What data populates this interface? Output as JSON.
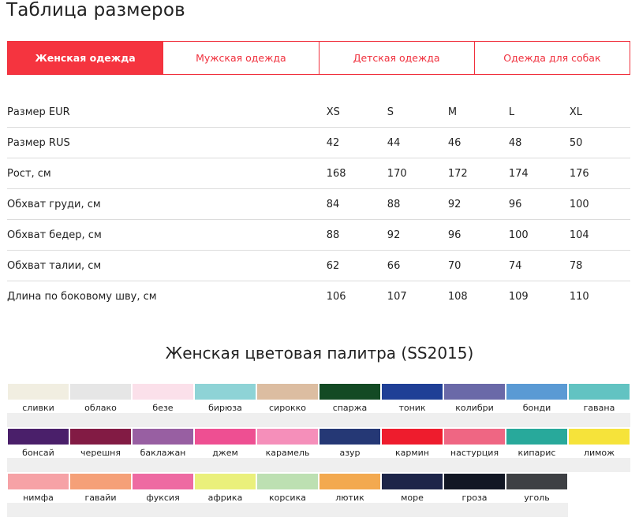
{
  "page": {
    "title": "Таблица размеров"
  },
  "tabs": [
    {
      "label": "Женская одежда",
      "active": true
    },
    {
      "label": "Мужская одежда",
      "active": false
    },
    {
      "label": "Детская одежда",
      "active": false
    },
    {
      "label": "Одежда для собак",
      "active": false
    }
  ],
  "size_table": {
    "rows": [
      {
        "label": "Размер EUR",
        "values": [
          "XS",
          "S",
          "M",
          "L",
          "XL"
        ]
      },
      {
        "label": "Размер RUS",
        "values": [
          "42",
          "44",
          "46",
          "48",
          "50"
        ]
      },
      {
        "label": "Рост, см",
        "values": [
          "168",
          "170",
          "172",
          "174",
          "176"
        ]
      },
      {
        "label": "Обхват груди, см",
        "values": [
          "84",
          "88",
          "92",
          "96",
          "100"
        ]
      },
      {
        "label": "Обхват бедер, см",
        "values": [
          "88",
          "92",
          "96",
          "100",
          "104"
        ]
      },
      {
        "label": "Обхват талии, см",
        "values": [
          "62",
          "66",
          "70",
          "74",
          "78"
        ]
      },
      {
        "label": "Длина по боковому шву, см",
        "values": [
          "106",
          "107",
          "108",
          "109",
          "110"
        ]
      }
    ]
  },
  "palette": {
    "title": "Женская цветовая палитра (SS2015)",
    "rows": [
      [
        {
          "name": "сливки",
          "color": "#f1eee1"
        },
        {
          "name": "облако",
          "color": "#e6e6e6"
        },
        {
          "name": "безе",
          "color": "#fbe0ea"
        },
        {
          "name": "бирюза",
          "color": "#8ed3d6"
        },
        {
          "name": "сирокко",
          "color": "#dcbda1"
        },
        {
          "name": "спаржа",
          "color": "#134a24"
        },
        {
          "name": "тоник",
          "color": "#1f3f96"
        },
        {
          "name": "колибри",
          "color": "#6a69a8"
        },
        {
          "name": "бонди",
          "color": "#5a9ad4"
        },
        {
          "name": "гавана",
          "color": "#62c3c2"
        }
      ],
      [
        {
          "name": "бонсай",
          "color": "#4a1f6a"
        },
        {
          "name": "черешня",
          "color": "#821b44"
        },
        {
          "name": "баклажан",
          "color": "#985fa2"
        },
        {
          "name": "джем",
          "color": "#ee4f92"
        },
        {
          "name": "карамель",
          "color": "#f58fba"
        },
        {
          "name": "азур",
          "color": "#253875"
        },
        {
          "name": "кармин",
          "color": "#ee1c2d"
        },
        {
          "name": "настурция",
          "color": "#ef6683"
        },
        {
          "name": "кипарис",
          "color": "#28a99b"
        },
        {
          "name": "лимож",
          "color": "#f6e33a"
        }
      ],
      [
        {
          "name": "нимфа",
          "color": "#f6a2a6"
        },
        {
          "name": "гавайи",
          "color": "#f5a078"
        },
        {
          "name": "фуксия",
          "color": "#ee6aa2"
        },
        {
          "name": "африка",
          "color": "#eaf07b"
        },
        {
          "name": "корсика",
          "color": "#bde0b2"
        },
        {
          "name": "лютик",
          "color": "#f3a94f"
        },
        {
          "name": "море",
          "color": "#1d2549"
        },
        {
          "name": "гроза",
          "color": "#121724"
        },
        {
          "name": "уголь",
          "color": "#3e4044"
        }
      ]
    ]
  }
}
